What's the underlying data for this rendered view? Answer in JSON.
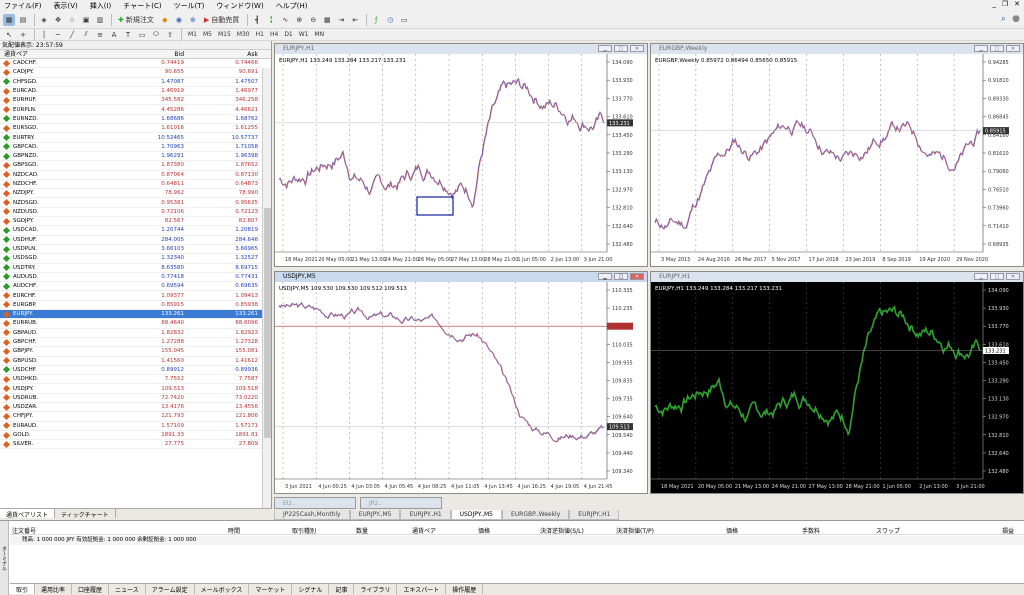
{
  "menu": [
    "ファイル(F)",
    "表示(V)",
    "挿入(I)",
    "チャート(C)",
    "ツール(T)",
    "ウィンドウ(W)",
    "ヘルプ(H)"
  ],
  "toolbar": {
    "new_order": "新規注文",
    "autotrade": "自動売買",
    "timeframes": [
      "M1",
      "M5",
      "M15",
      "M30",
      "H1",
      "H4",
      "D1",
      "W1",
      "MN"
    ]
  },
  "market_watch": {
    "title": "気配値表示: 23:57:59",
    "col_symbol": "通貨ペア",
    "col_bid": "Bid",
    "col_ask": "Ask",
    "rows": [
      [
        "CADCHF.",
        "0.74419",
        "0.74466",
        "r"
      ],
      [
        "CADJPY.",
        "90.655",
        "90.691",
        "r"
      ],
      [
        "CHFSGD.",
        "1.47087",
        "1.47507",
        "b"
      ],
      [
        "EURCAD.",
        "1.46919",
        "1.46977",
        "r"
      ],
      [
        "EURHUF.",
        "345.582",
        "346.258",
        "r"
      ],
      [
        "EURPLN.",
        "4.45286",
        "4.46621",
        "r"
      ],
      [
        "EURNZD.",
        "1.68686",
        "1.68762",
        "b"
      ],
      [
        "EURSGD.",
        "1.61016",
        "1.61255",
        "r"
      ],
      [
        "EURTRY.",
        "10.52465",
        "10.57737",
        "b"
      ],
      [
        "GBPCAD.",
        "1.70963",
        "1.71058",
        "b"
      ],
      [
        "GBPNZD.",
        "1.96291",
        "1.96398",
        "b"
      ],
      [
        "GBPSGD.",
        "1.87380",
        "1.87652",
        "r"
      ],
      [
        "NZDCAD.",
        "0.87064",
        "0.87130",
        "r"
      ],
      [
        "NZDCHF.",
        "0.64811",
        "0.64873",
        "r"
      ],
      [
        "NZDJPY.",
        "78.962",
        "78.990",
        "r"
      ],
      [
        "NZDSGD.",
        "0.95381",
        "0.95635",
        "r"
      ],
      [
        "NZDUSD.",
        "0.72106",
        "0.72123",
        "r"
      ],
      [
        "SGDJPY.",
        "82.567",
        "82.807",
        "r"
      ],
      [
        "USDCAD.",
        "1.20744",
        "1.20819",
        "b"
      ],
      [
        "USDHUF.",
        "284.005",
        "284.646",
        "b"
      ],
      [
        "USDPLN.",
        "3.66103",
        "3.66965",
        "b"
      ],
      [
        "USDSGD.",
        "1.32340",
        "1.32527",
        "b"
      ],
      [
        "USDTRY.",
        "8.63580",
        "8.69715",
        "b"
      ],
      [
        "AUDUSD.",
        "0.77418",
        "0.77431",
        "b"
      ],
      [
        "AUDCHF.",
        "0.69594",
        "0.69635",
        "b"
      ],
      [
        "EURCHF.",
        "1.09377",
        "1.09413",
        "r"
      ],
      [
        "EURGBP.",
        "0.85915",
        "0.85938",
        "r"
      ],
      [
        "EURJPY.",
        "133.261",
        "133.261",
        "s"
      ],
      [
        "EURRUB.",
        "88.4640",
        "88.6096",
        "r"
      ],
      [
        "GBPAUD.",
        "1.82832",
        "1.82923",
        "r"
      ],
      [
        "GBPCHF.",
        "1.27288",
        "1.27328",
        "r"
      ],
      [
        "GBPJPY.",
        "155.045",
        "155.081",
        "r"
      ],
      [
        "GBPUSD.",
        "1.41560",
        "1.41612",
        "r"
      ],
      [
        "USDCHF.",
        "0.89912",
        "0.89936",
        "b"
      ],
      [
        "USDHKD.",
        "7.7552",
        "7.7587",
        "r"
      ],
      [
        "USDJPY.",
        "109.513",
        "109.518",
        "r"
      ],
      [
        "USDRUB.",
        "72.7420",
        "73.0220",
        "r"
      ],
      [
        "USDZAR.",
        "13.4176",
        "13.4556",
        "r"
      ],
      [
        "CHFJPY.",
        "121.793",
        "121.806",
        "r"
      ],
      [
        "EURAUD.",
        "1.57109",
        "1.57171",
        "r"
      ],
      [
        "GOLD.",
        "1891.33",
        "1891.81",
        "r"
      ],
      [
        "SILVER.",
        "27.775",
        "27.809",
        "r"
      ]
    ],
    "tabs": [
      "通貨ペアリスト",
      "ティックチャート"
    ]
  },
  "charts": {
    "eurjpy": {
      "title": "EURJPY,H1",
      "info": "EURJPY,H1  133.249 133.284 133.217 133.231",
      "prices": [
        "134.090",
        "133.930",
        "133.770",
        "133.610",
        "133.450",
        "133.290",
        "133.130",
        "132.970",
        "132.810",
        "132.640",
        "132.480"
      ],
      "current": "133.231",
      "dates": [
        "18 May 2021",
        "20 May 05:00",
        "21 May 13:00",
        "24 May 21:00",
        "26 May 05:00",
        "27 May 13:00",
        "28 May 21:00",
        "1 Jun 05:00",
        "2 Jun 13:00",
        "3 Jun 21:00"
      ]
    },
    "eurgbp": {
      "title": "EURGBP,Weekly",
      "info": "EURGBP,Weekly  0.85972 0.86494 0.85650 0.85915",
      "prices": [
        "0.94285",
        "0.91810",
        "0.89330",
        "0.86845",
        "0.84160",
        "0.81610",
        "0.79060",
        "0.76510",
        "0.73960",
        "0.71410",
        "0.68935"
      ],
      "current": "0.85915",
      "dates": [
        "3 May 2015",
        "24 Aug 2016",
        "26 Mar 2017",
        "5 Nov 2017",
        "17 Jun 2018",
        "23 Jan 2019",
        "8 Sep 2019",
        "19 Apr 2020",
        "29 Nov 2020"
      ]
    },
    "usdjpy": {
      "title": "USDJPY,M5",
      "info": "USDJPY,M5  109.530 109.530 109.512 109.513",
      "prices": [
        "110.335",
        "110.235",
        "110.137",
        "110.035",
        "109.935",
        "109.835",
        "109.735",
        "109.640",
        "109.540",
        "109.440",
        "109.340"
      ],
      "current": "109.513",
      "dates": [
        "3 Jun 2021",
        "4 Jun 00:25",
        "4 Jun 03:05",
        "4 Jun 05:45",
        "4 Jun 08:25",
        "4 Jun 11:05",
        "4 Jun 13:45",
        "4 Jun 16:25",
        "4 Jun 19:05",
        "4 Jun 21:45"
      ]
    },
    "eurjpy2": {
      "title": "EURJPY,H1",
      "info": "EURJPY,H1  133.249 133.284 133.217 133.231",
      "prices": [
        "134.090",
        "133.930",
        "133.770",
        "133.610",
        "133.450",
        "133.290",
        "133.130",
        "132.970",
        "132.810",
        "132.640",
        "132.480"
      ],
      "current": "133.231",
      "dates": [
        "18 May 2021",
        "20 May 05:00",
        "21 May 13:00",
        "24 May 21:00",
        "27 May 13:00",
        "28 May 21:00",
        "1 Jun 05:00",
        "2 Jun 13:00",
        "3 Jun 21:00"
      ]
    }
  },
  "minimized": [
    "EU..",
    "JP2.."
  ],
  "chart_tabs": [
    "JP225Cash,Monthly",
    "EURJPY.,M5",
    "EURJPY.,H1",
    "USDJPY.,M5",
    "EURGBP.,Weekly",
    "EURJPY.,H1"
  ],
  "terminal": {
    "side": "ターミナル",
    "cols": [
      "注文番号",
      "時間",
      "取引種別",
      "数量",
      "通貨ペア",
      "価格",
      "決済逆指値(S/L)",
      "決済指値(T/P)",
      "価格",
      "手数料",
      "スワップ",
      "損益"
    ],
    "balance": "残高: 1 000 000 JPY  有効証拠金: 1 000 000  余剰証拠金: 1 000 000",
    "tabs": [
      "取引",
      "運用比率",
      "口座履歴",
      "ニュース",
      "アラーム設定",
      "メールボックス",
      "マーケット",
      "シグナル",
      "記事",
      "ライブラリ",
      "エキスパート",
      "操作履歴"
    ]
  },
  "colors": {
    "up": "#c03030",
    "down": "#2040c0",
    "selected": "#3a7bd5",
    "chart_green": "#2fa22f"
  }
}
